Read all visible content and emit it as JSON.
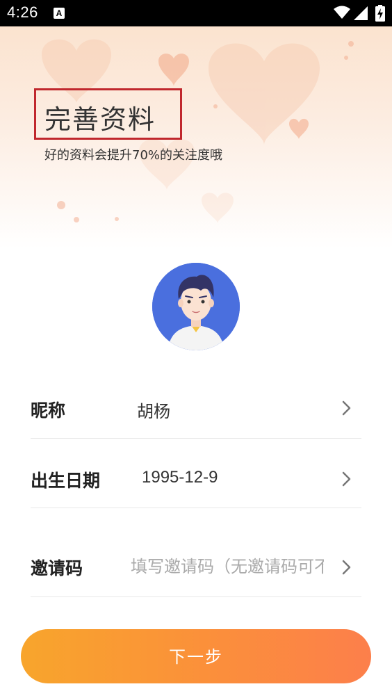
{
  "status_bar": {
    "time": "4:26",
    "app_icon_letter": "A"
  },
  "header": {
    "title": "完善资料",
    "subtitle": "好的资料会提升70%的关注度哦"
  },
  "form": {
    "nickname": {
      "label": "昵称",
      "value": "胡杨"
    },
    "birthday": {
      "label": "出生日期",
      "value": "1995-12-9"
    },
    "invite_code": {
      "label": "邀请码",
      "placeholder": "填写邀请码（无邀请码可不填）",
      "value": ""
    }
  },
  "next_button": {
    "label": "下一步"
  },
  "colors": {
    "button_gradient_start": "#f8a52c",
    "button_gradient_end": "#fc7f4b",
    "avatar_bg": "#4a6fde",
    "title_highlight_border": "#c0272d"
  }
}
